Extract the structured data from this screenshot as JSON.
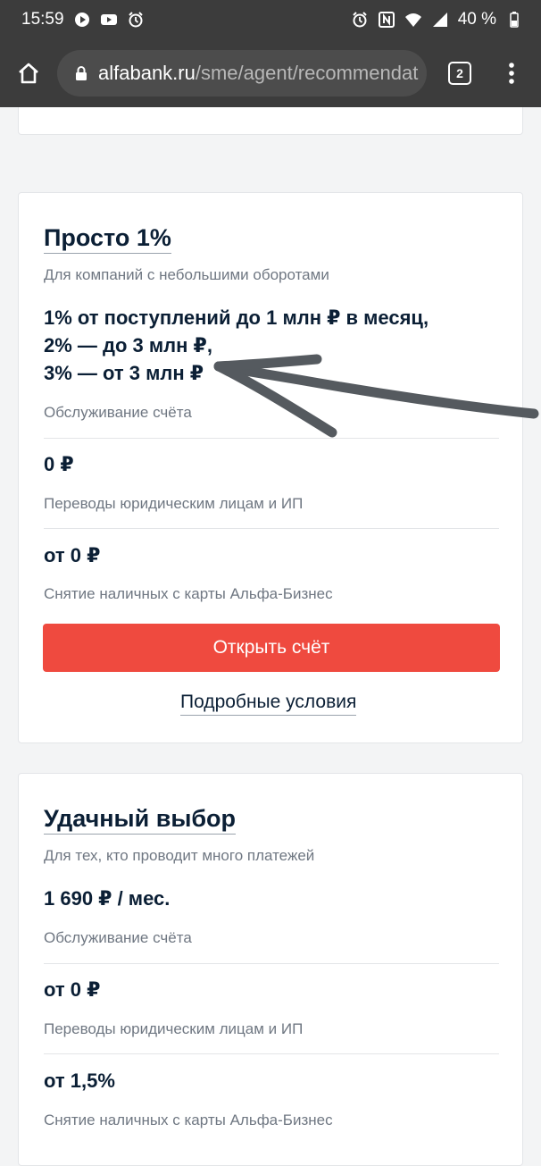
{
  "status_bar": {
    "time": "15:59",
    "battery": "40 %",
    "icons": [
      "media-play-icon",
      "youtube-icon",
      "alarm-icon",
      "alarm-icon",
      "nfc-icon",
      "wifi-icon",
      "signal-icon",
      "battery-icon"
    ]
  },
  "browser": {
    "url_domain": "alfabank.ru",
    "url_path": "/sme/agent/recommendat",
    "tab_count": "2"
  },
  "cards": [
    {
      "title": "Просто 1%",
      "subtitle": "Для компаний с небольшими оборотами",
      "price_lines": [
        "1% от поступлений до 1 млн ₽ в месяц,",
        "2% — до 3 млн ₽,",
        "3% — от 3 млн ₽"
      ],
      "price_label": "Обслуживание счёта",
      "transfer_value": "0 ₽",
      "transfer_label": "Переводы юридическим лицам и ИП",
      "cash_value": "от 0 ₽",
      "cash_label": "Снятие наличных с карты Альфа-Бизнес",
      "open_button": "Открыть счёт",
      "details_link": "Подробные условия"
    },
    {
      "title": "Удачный выбор",
      "subtitle": "Для тех, кто проводит много платежей",
      "price": "1 690 ₽ / мес.",
      "price_label": "Обслуживание счёта",
      "transfer_value": "от 0 ₽",
      "transfer_label": "Переводы юридическим лицам и ИП",
      "cash_value": "от 1,5%",
      "cash_label": "Снятие наличных с карты Альфа-Бизнес"
    }
  ],
  "colors": {
    "accent": "#ef4a3f",
    "text": "#0b1f35",
    "muted": "#6f7782",
    "browser_bar": "#3c3c3c"
  }
}
